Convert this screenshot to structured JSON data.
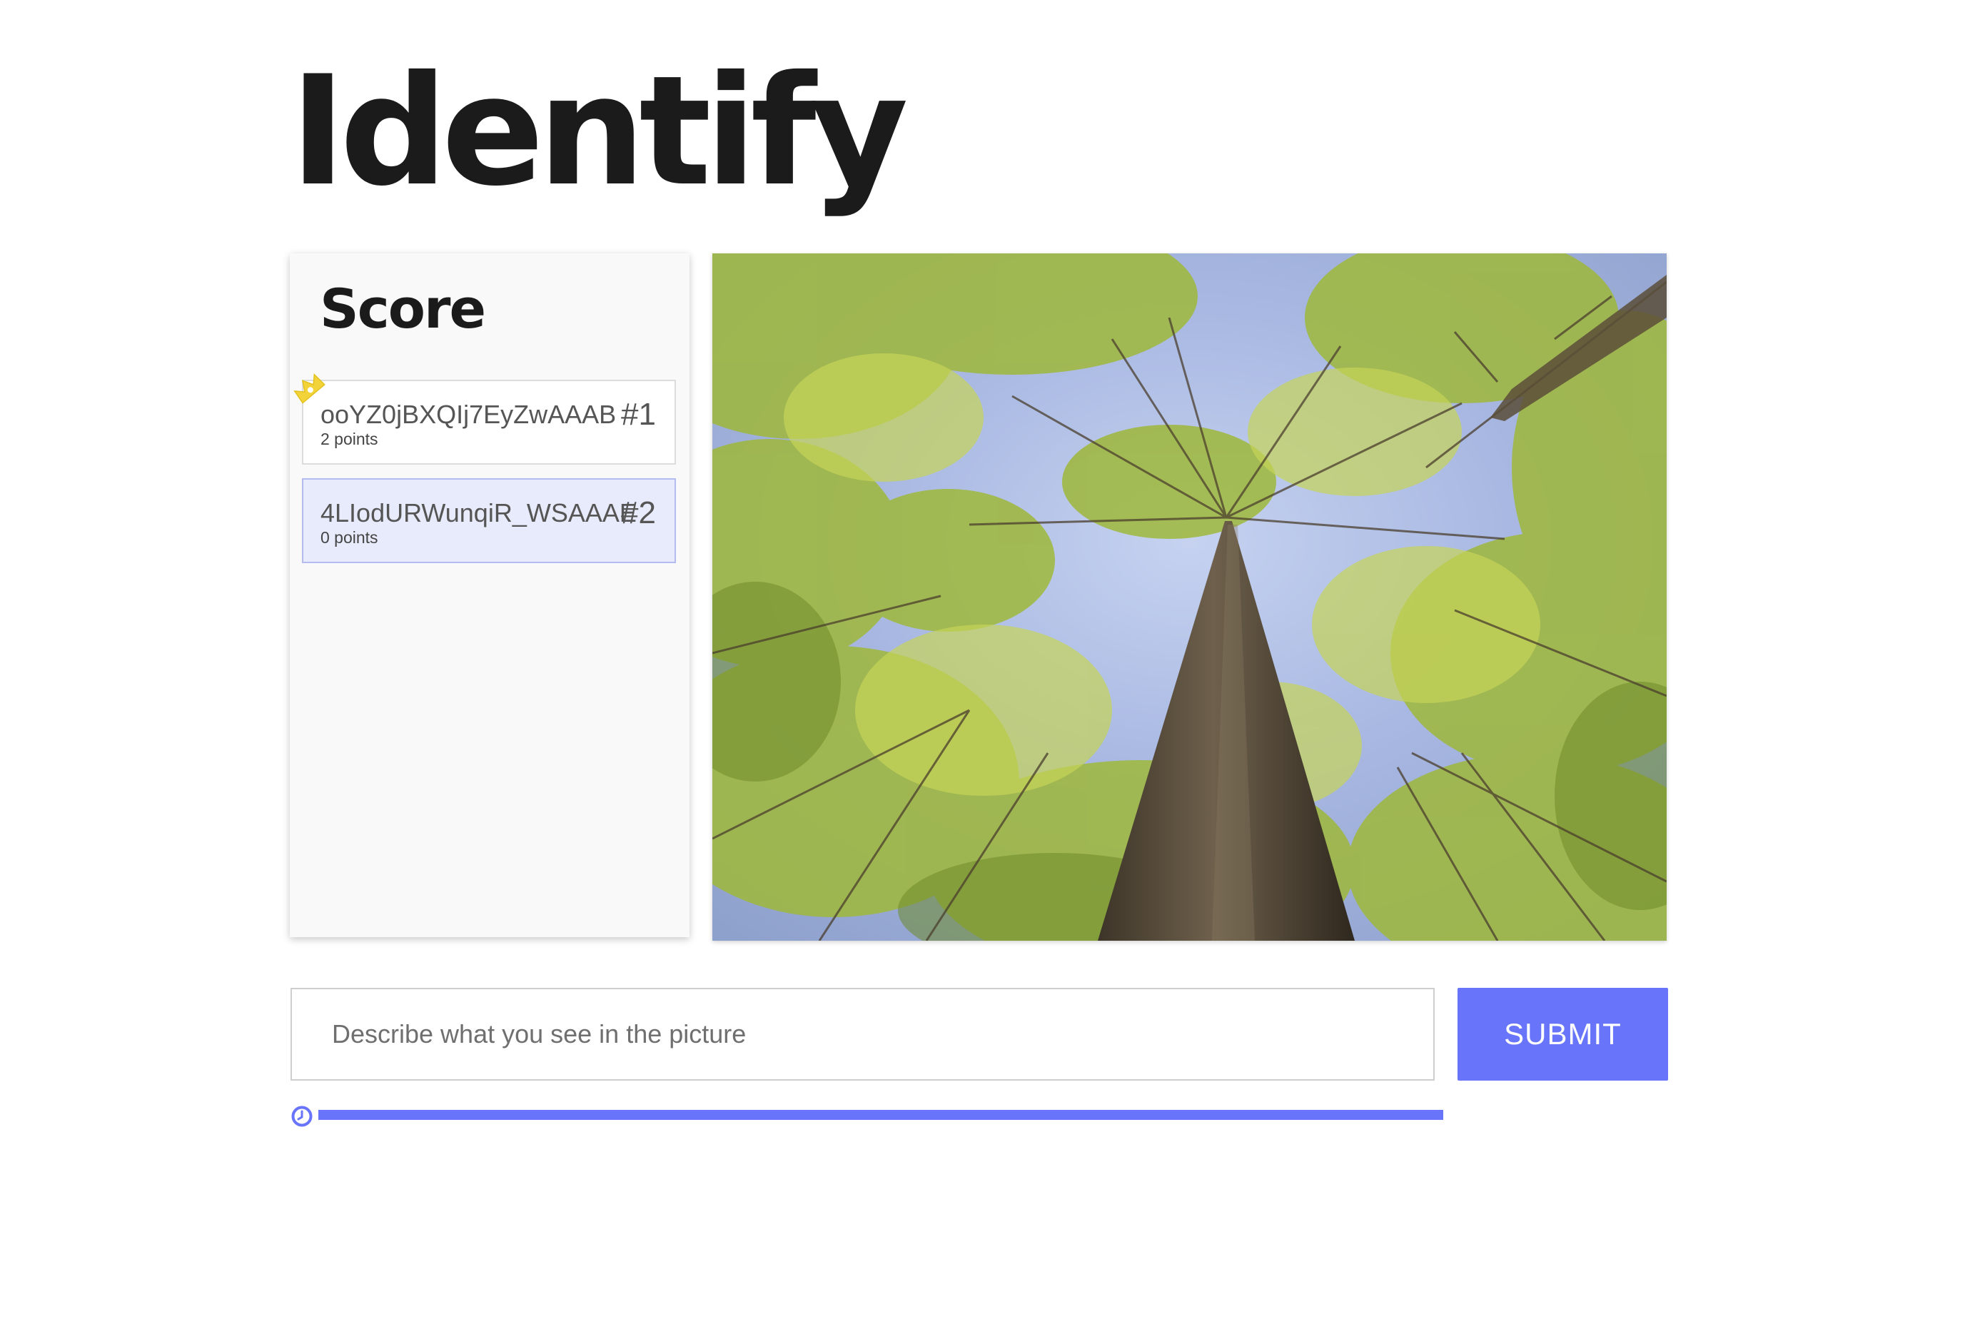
{
  "app": {
    "title": "Identify"
  },
  "scoreboard": {
    "heading": "Score",
    "players": [
      {
        "name": "ooYZ0jBXQIj7EyZwAAAB",
        "points": "2 points",
        "rank": "#1",
        "leader": true,
        "current_user": false
      },
      {
        "name": "4LIodURWunqiR_WSAAAE",
        "points": "0 points",
        "rank": "#2",
        "leader": false,
        "current_user": true
      }
    ]
  },
  "picture": {
    "subject": "forest-canopy-photo"
  },
  "guess": {
    "placeholder": "Describe what you see in the picture",
    "value": "",
    "submit_label": "SUBMIT"
  },
  "timer": {
    "icon": "clock-icon",
    "remaining_fraction": 1.0
  },
  "colors": {
    "accent": "#6874fa",
    "active_card_bg": "#e8ebfb",
    "crown": "#f2d43a",
    "title": "#1b1b1b"
  }
}
